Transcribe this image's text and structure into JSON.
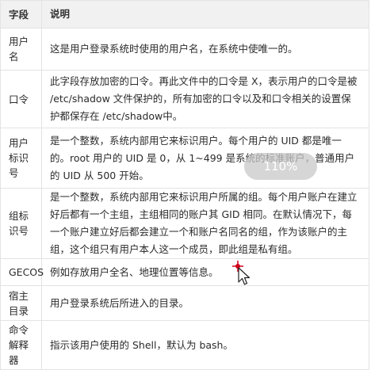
{
  "table": {
    "headers": {
      "field": "字段",
      "desc": "说明"
    },
    "rows": [
      {
        "field": "用户名",
        "desc": "这是用户登录系统时使用的用户名，在系统中使唯一的。"
      },
      {
        "field": "口令",
        "desc": "此字段存放加密的口令。再此文件中的口令是 X，表示用户的口令是被 /etc/shadow 文件保护的，所有加密的口令以及和口令相关的设置保护都保存在 /etc/shadow中。"
      },
      {
        "field": "用户标识号",
        "desc": "是一个整数，系统内部用它来标识用户。每个用户的 UID 都是唯一的。root 用户的 UID 是 0，从 1~499 是系统的标准账户，普通用户的 UID 从 500 开始。"
      },
      {
        "field": "组标识号",
        "desc": "是一个整数，系统内部用它来标识用户所属的组。每个用户账户在建立好后都有一个主组，主组相同的账户其 GID 相同。在默认情况下，每一个账户建立好后都会建立一个和账户名同名的组，作为该账户的主组，这个组只有用户本人这一个成员，即此组是私有组。"
      },
      {
        "field": "GECOS",
        "desc": "例如存放用户全名、地理位置等信息。"
      },
      {
        "field": "宿主目录",
        "desc": "用户登录系统后所进入的目录。"
      },
      {
        "field": "命令解释器",
        "desc": "指示该用户使用的 Shell，默认为 bash。"
      }
    ]
  },
  "zoom_indicator": "110%",
  "colors": {
    "header_bg": "#f1f1f1",
    "border": "#e3e3e3",
    "cursor_accent": "#d0021b"
  }
}
